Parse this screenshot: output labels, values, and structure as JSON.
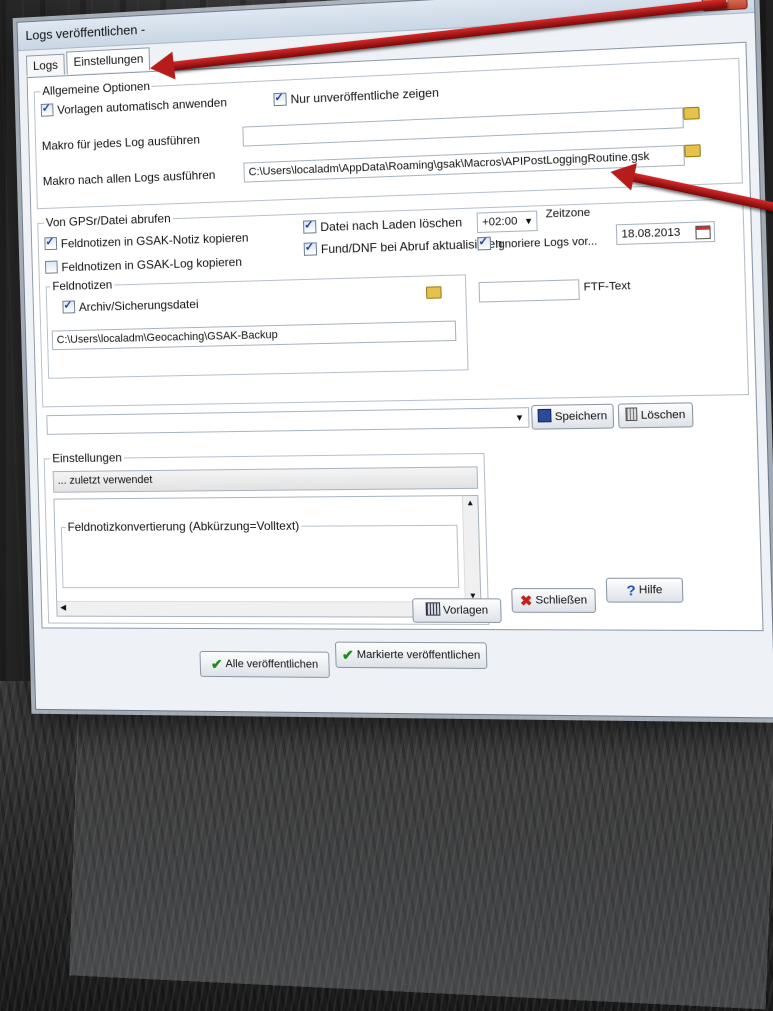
{
  "window": {
    "title": "Logs veröffentlichen -",
    "close_label": "x"
  },
  "tabs": [
    {
      "label": "Logs"
    },
    {
      "label": "Einstellungen"
    }
  ],
  "allgemein": {
    "legend": "Allgemeine Optionen",
    "vorlagen_auto": {
      "label": "Vorlagen automatisch anwenden",
      "checked": true
    },
    "nur_unveroeffentlicht": {
      "label": "Nur unveröffentliche zeigen",
      "checked": true
    },
    "makro_jedes_label": "Makro für jedes Log ausführen",
    "makro_jedes_value": "",
    "makro_allen_label": "Makro nach allen Logs ausführen",
    "makro_allen_value": "C:\\Users\\localadm\\AppData\\Roaming\\gsak\\Macros\\APIPostLoggingRoutine.gsk"
  },
  "gps": {
    "legend": "Von GPSr/Datei abrufen",
    "feldnotizen_notiz": {
      "label": "Feldnotizen in GSAK-Notiz kopieren",
      "checked": true
    },
    "feldnotizen_log": {
      "label": "Feldnotizen in GSAK-Log kopieren",
      "checked": false
    },
    "datei_loeschen": {
      "label": "Datei nach Laden löschen",
      "checked": true
    },
    "fund_dnf": {
      "label": "Fund/DNF bei Abruf aktualisieren",
      "checked": true
    },
    "ignoriere_logs": {
      "label": "Ignoriere Logs vor...",
      "checked": true
    },
    "zeitzone_value": "+02:00",
    "zeitzone_label": "Zeitzone",
    "date_value": "18.08.2013",
    "ftf_label": "FTF-Text",
    "ftf_value": "",
    "feldnotizen_legend": "Feldnotizen",
    "archiv": {
      "label": "Archiv/Sicherungsdatei",
      "checked": true
    },
    "backup_path": "C:\\Users\\localadm\\Geocaching\\GSAK-Backup"
  },
  "profile": {
    "value": "",
    "save_label": "Speichern",
    "delete_label": "Löschen"
  },
  "einstellungen": {
    "legend": "Einstellungen",
    "value": "... zuletzt verwendet"
  },
  "konvertierung": {
    "legend": "Feldnotizkonvertierung (Abkürzung=Volltext)"
  },
  "buttons": {
    "vorlagen": "Vorlagen",
    "schliessen": "Schließen",
    "hilfe": "Hilfe",
    "alle": "Alle veröffentlichen",
    "markierte": "Markierte veröffentlichen"
  }
}
